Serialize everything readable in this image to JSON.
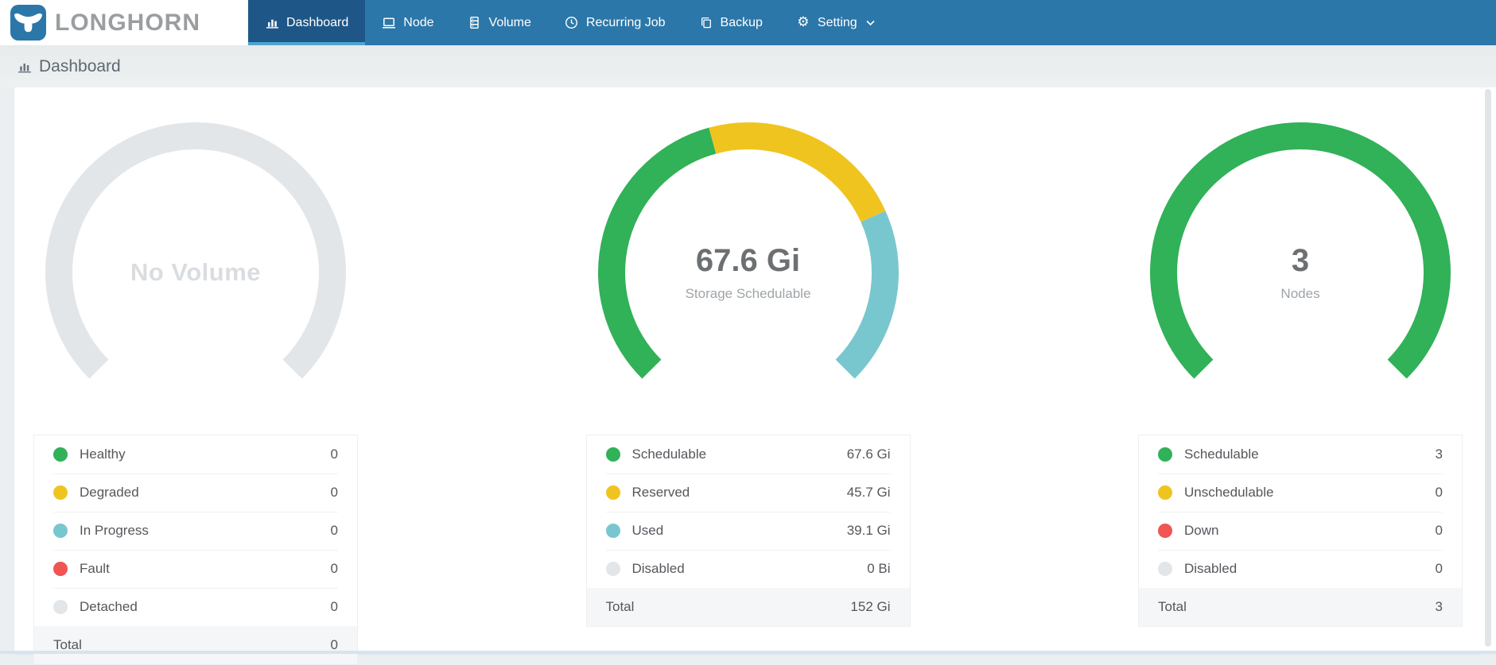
{
  "navbar": {
    "brand": "LONGHORN",
    "logo_icon": "longhorn-bull-icon",
    "items": [
      {
        "label": "Dashboard",
        "icon": "bar-chart-icon",
        "active": true
      },
      {
        "label": "Node",
        "icon": "laptop-icon",
        "active": false
      },
      {
        "label": "Volume",
        "icon": "volume-server-icon",
        "active": false
      },
      {
        "label": "Recurring Job",
        "icon": "clock-icon",
        "active": false
      },
      {
        "label": "Backup",
        "icon": "backup-copy-icon",
        "active": false
      },
      {
        "label": "Setting",
        "icon": "gear-icon",
        "active": false,
        "has_dropdown": true
      }
    ]
  },
  "page": {
    "title": "Dashboard",
    "title_icon": "bar-chart-icon"
  },
  "colors": {
    "navbar_bg": "#2C77A9",
    "navbar_active_bg": "#1E5787",
    "navbar_active_underline": "#4FA5CF",
    "page_bg": "#ECEFF1",
    "card_bg": "#FFFFFF",
    "green": "#31B158",
    "yellow": "#F0C41F",
    "teal": "#79C7CE",
    "red": "#F05453",
    "gray": "#E3E6E8",
    "total_row_bg": "#F4F6F7"
  },
  "chart_data": [
    {
      "type": "gauge-donut",
      "empty": true,
      "center_value": "No Volume",
      "center_sub": "",
      "arc_degrees": 270,
      "segments": [],
      "legend": [
        {
          "label": "Healthy",
          "value": "0",
          "color_key": "green"
        },
        {
          "label": "Degraded",
          "value": "0",
          "color_key": "yellow"
        },
        {
          "label": "In Progress",
          "value": "0",
          "color_key": "teal"
        },
        {
          "label": "Fault",
          "value": "0",
          "color_key": "red"
        },
        {
          "label": "Detached",
          "value": "0",
          "color_key": "gray"
        }
      ],
      "total_label": "Total",
      "total_value": "0"
    },
    {
      "type": "gauge-donut",
      "empty": false,
      "center_value": "67.6 Gi",
      "center_sub": "Storage Schedulable",
      "arc_degrees": 270,
      "segments": [
        {
          "name": "Schedulable",
          "value": 67.6,
          "color_key": "green"
        },
        {
          "name": "Reserved",
          "value": 45.7,
          "color_key": "yellow"
        },
        {
          "name": "Used",
          "value": 39.1,
          "color_key": "teal"
        },
        {
          "name": "Disabled",
          "value": 0,
          "color_key": "gray"
        }
      ],
      "legend": [
        {
          "label": "Schedulable",
          "value": "67.6 Gi",
          "color_key": "green"
        },
        {
          "label": "Reserved",
          "value": "45.7 Gi",
          "color_key": "yellow"
        },
        {
          "label": "Used",
          "value": "39.1 Gi",
          "color_key": "teal"
        },
        {
          "label": "Disabled",
          "value": "0 Bi",
          "color_key": "gray"
        }
      ],
      "total_label": "Total",
      "total_value": "152 Gi"
    },
    {
      "type": "gauge-donut",
      "empty": false,
      "center_value": "3",
      "center_sub": "Nodes",
      "arc_degrees": 270,
      "segments": [
        {
          "name": "Schedulable",
          "value": 3,
          "color_key": "green"
        },
        {
          "name": "Unschedulable",
          "value": 0,
          "color_key": "yellow"
        },
        {
          "name": "Down",
          "value": 0,
          "color_key": "red"
        },
        {
          "name": "Disabled",
          "value": 0,
          "color_key": "gray"
        }
      ],
      "legend": [
        {
          "label": "Schedulable",
          "value": "3",
          "color_key": "green"
        },
        {
          "label": "Unschedulable",
          "value": "0",
          "color_key": "yellow"
        },
        {
          "label": "Down",
          "value": "0",
          "color_key": "red"
        },
        {
          "label": "Disabled",
          "value": "0",
          "color_key": "gray"
        }
      ],
      "total_label": "Total",
      "total_value": "3"
    }
  ]
}
